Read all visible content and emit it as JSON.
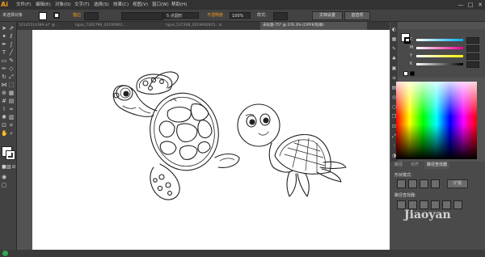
{
  "app": {
    "logo": "Ai"
  },
  "menubar": {
    "items": [
      "文件(F)",
      "编辑(E)",
      "对象(O)",
      "文字(T)",
      "选择(S)",
      "效果(C)",
      "视图(V)",
      "窗口(W)",
      "帮助(H)"
    ],
    "window_controls": [
      "—",
      "□",
      "✕"
    ]
  },
  "controlbar": {
    "selection_label": "未选择对象",
    "stroke_label": "描边",
    "stroke_value": "",
    "brush_label": "5 点圆形",
    "opacity_label": "不透明度",
    "opacity_value": "100%",
    "style_label": "样式:",
    "doc_settings": "文档设置",
    "preferences": "首选项"
  },
  "tabs": [
    {
      "label": "1014151438¥.ai* @ ..."
    },
    {
      "label": "hjpai_7262799_20190902..."
    },
    {
      "label": "hjpai_537308_2019092915...ai"
    },
    {
      "label": "未标题-75* @ 276.3% (CMYK/轮廓)"
    }
  ],
  "color_panel": {
    "sliders": [
      {
        "label": "C",
        "color": "#00aeef"
      },
      {
        "label": "M",
        "color": "#ec008c"
      },
      {
        "label": "Y",
        "color": "#fff200"
      },
      {
        "label": "K",
        "color": "#000000"
      }
    ]
  },
  "pathfinder": {
    "tabs": [
      "路径",
      "对齐",
      "路径查找器"
    ],
    "shape_modes_label": "形状模式:",
    "pathfinders_label": "路径查找器:",
    "expand_label": "扩展"
  },
  "watermark": "Jiaoyan"
}
